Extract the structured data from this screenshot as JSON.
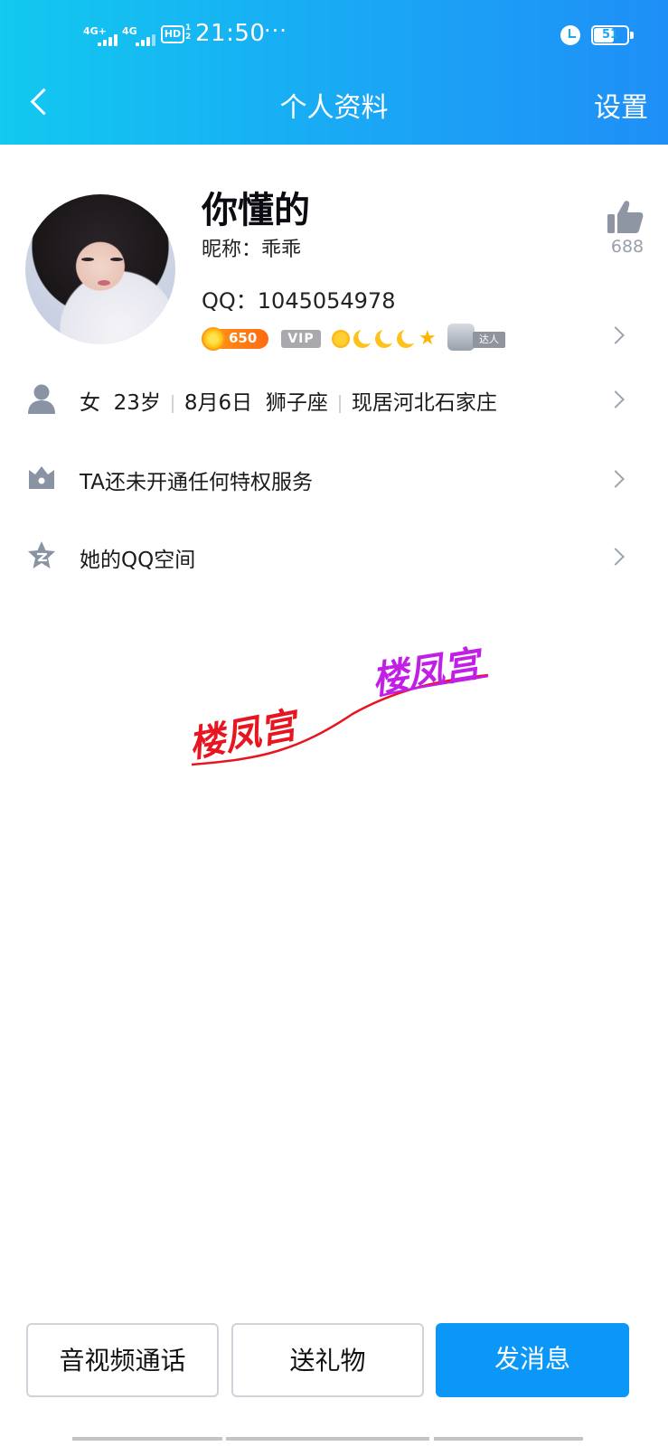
{
  "status_bar": {
    "sim1": "4G+",
    "sim2": "4G",
    "hd_label": "HD",
    "hd_sub": "1\n2",
    "time": "21:50",
    "more": "···",
    "battery": "51"
  },
  "header": {
    "back_icon": "chevron-left-icon",
    "title": "个人资料",
    "settings": "设置"
  },
  "profile": {
    "name": "你懂的",
    "nickname": "昵称：乖乖",
    "qq": "QQ：1045054978",
    "likes": "688",
    "coin_count": "650",
    "vip_label": "VIP",
    "daren_label": "达人"
  },
  "rows": [
    {
      "icon": "person-icon",
      "gender": "女",
      "age": "23岁",
      "birthday": "8月6日",
      "zodiac": "狮子座",
      "location": "现居河北石家庄"
    },
    {
      "icon": "crown-icon",
      "label": "TA还未开通任何特权服务"
    },
    {
      "icon": "qzone-star-icon",
      "label": "她的QQ空间"
    }
  ],
  "watermark": {
    "text1": "楼凤宫",
    "text2": "楼凤宫",
    "color1": "#e8141f",
    "color2": "#c21fe6"
  },
  "actions": {
    "call": "音视频通话",
    "gift": "送礼物",
    "message": "发消息"
  },
  "colors": {
    "header_start": "#12c9ef",
    "header_end": "#1e8ff7",
    "primary": "#0a97f7"
  }
}
